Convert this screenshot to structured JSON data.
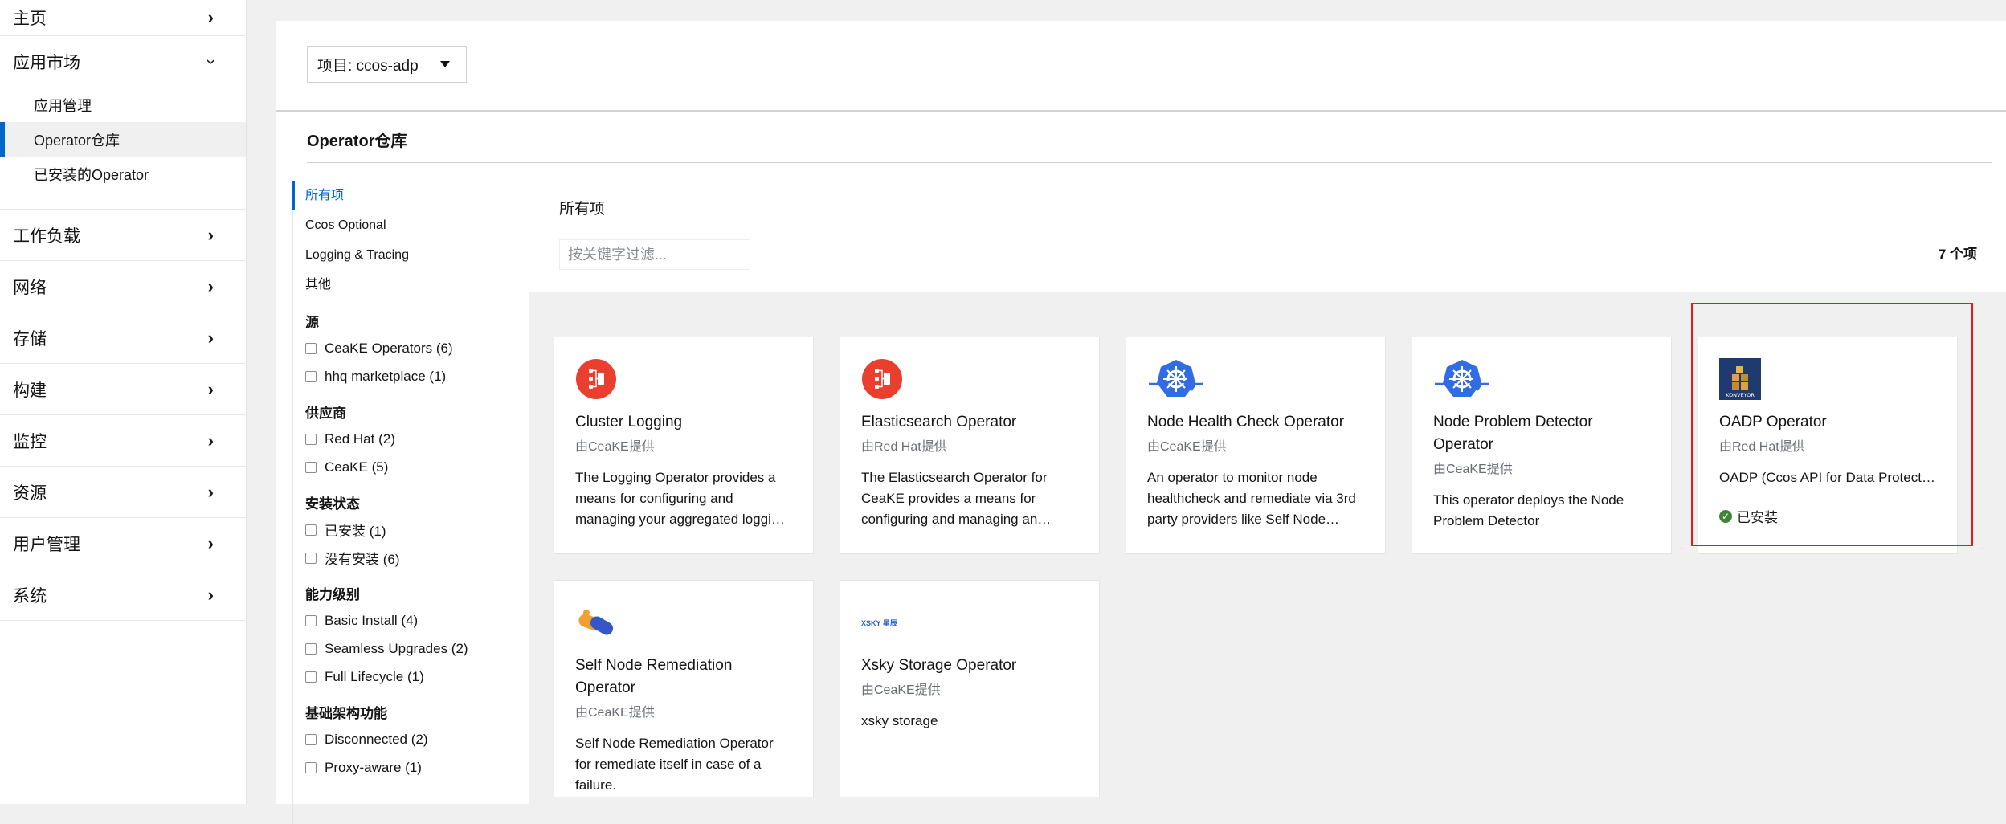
{
  "sidebar": {
    "home": "主页",
    "appmarket": {
      "label": "应用市场",
      "items": [
        "应用管理",
        "Operator仓库",
        "已安装的Operator"
      ]
    },
    "sections": [
      "工作负载",
      "网络",
      "存储",
      "构建",
      "监控",
      "资源",
      "用户管理",
      "系统"
    ]
  },
  "project_select": "项目: ccos-adp",
  "page_title": "Operator仓库",
  "categories": [
    "所有项",
    "Ccos Optional",
    "Logging & Tracing",
    "其他"
  ],
  "filter_groups": [
    {
      "title": "源",
      "options": [
        "CeaKE Operators (6)",
        "hhq marketplace (1)"
      ]
    },
    {
      "title": "供应商",
      "options": [
        "Red Hat (2)",
        "CeaKE (5)"
      ]
    },
    {
      "title": "安装状态",
      "options": [
        "已安装 (1)",
        "没有安装 (6)"
      ]
    },
    {
      "title": "能力级别",
      "options": [
        "Basic Install (4)",
        "Seamless Upgrades (2)",
        "Full Lifecycle (1)"
      ]
    },
    {
      "title": "基础架构功能",
      "options": [
        "Disconnected (2)",
        "Proxy-aware (1)"
      ]
    }
  ],
  "content": {
    "heading": "所有项",
    "filter_placeholder": "按关键字过滤...",
    "count": "7 个项"
  },
  "tiles": [
    {
      "name": "Cluster Logging",
      "provider": "由CeaKE提供",
      "desc": "The Logging Operator provides a means for configuring and managing your aggregated logging stack.",
      "icon": "logging-icon"
    },
    {
      "name": "Elasticsearch Operator",
      "provider": "由Red Hat提供",
      "desc": "The Elasticsearch Operator for CeaKE provides a means for configuring and managing an Elasticsearch cluster.",
      "icon": "elasticsearch-icon"
    },
    {
      "name": "Node Health Check Operator",
      "provider": "由CeaKE提供",
      "desc": "An operator to monitor node healthcheck and remediate via 3rd party providers like Self Node Remediation.",
      "icon": "k8s-health-icon"
    },
    {
      "name": "Node Problem Detector Operator",
      "provider": "由CeaKE提供",
      "desc": "This operator deploys the Node Problem Detector",
      "icon": "k8s-health-icon"
    },
    {
      "name": "OADP Operator",
      "provider": "由Red Hat提供",
      "desc": "OADP (Ccos API for Data Protection) operator",
      "status": "已安装",
      "icon": "konveyor-icon",
      "logo_text": "KONVEYOR"
    },
    {
      "name": "Self Node Remediation Operator",
      "provider": "由CeaKE提供",
      "desc": "Self Node Remediation Operator for remediate itself in case of a failure.",
      "icon": "capsule-icon"
    },
    {
      "name": "Xsky Storage Operator",
      "provider": "由CeaKE提供",
      "desc": "xsky storage",
      "icon": "xsky-logo-icon",
      "logo_text": "XSKY 星辰"
    }
  ],
  "colors": {
    "accent": "#0066cc",
    "highlight": "#e01b24",
    "installed": "#3e8635",
    "logging": "#ea3f2e",
    "k8s": "#326ce5"
  }
}
